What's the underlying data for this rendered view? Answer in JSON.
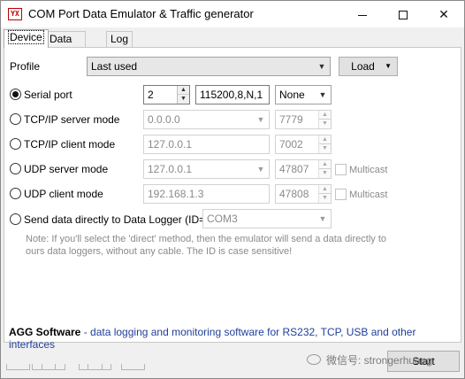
{
  "window": {
    "title": "COM Port Data Emulator & Traffic generator",
    "icon_label": "YX",
    "controls": [
      "minimize",
      "maximize",
      "close"
    ]
  },
  "tabs": [
    {
      "label": "Device",
      "active": true
    },
    {
      "label": "Data source",
      "active": false
    },
    {
      "label": "Log",
      "active": false
    }
  ],
  "profile": {
    "label": "Profile",
    "value": "Last used",
    "load_button": "Load"
  },
  "modes": {
    "serial": {
      "label": "Serial port",
      "checked": true,
      "port": "2",
      "settings": "115200,8,N,1",
      "flow": "None"
    },
    "tcp_server": {
      "label": "TCP/IP server mode",
      "checked": false,
      "address": "0.0.0.0",
      "port": "7779"
    },
    "tcp_client": {
      "label": "TCP/IP client mode",
      "checked": false,
      "address": "127.0.0.1",
      "port": "7002"
    },
    "udp_server": {
      "label": "UDP server mode",
      "checked": false,
      "address": "127.0.0.1",
      "port": "47807",
      "multicast_label": "Multicast"
    },
    "udp_client": {
      "label": "UDP client mode",
      "checked": false,
      "address": "192.168.1.3",
      "port": "47808",
      "multicast_label": "Multicast"
    },
    "direct": {
      "label": "Send data directly to Data Logger (ID=)",
      "checked": false,
      "value": "COM3"
    }
  },
  "note": "Note: If you'll select the 'direct' method, then the emulator will send a data directly to ours data loggers, without any cable. The ID is case sensitive!",
  "footer": {
    "brand": "AGG Software",
    "tagline": " - data logging and monitoring software for RS232, TCP, USB and other interfaces"
  },
  "start_button": "Start",
  "watermark": "微信号: strongerhuang"
}
